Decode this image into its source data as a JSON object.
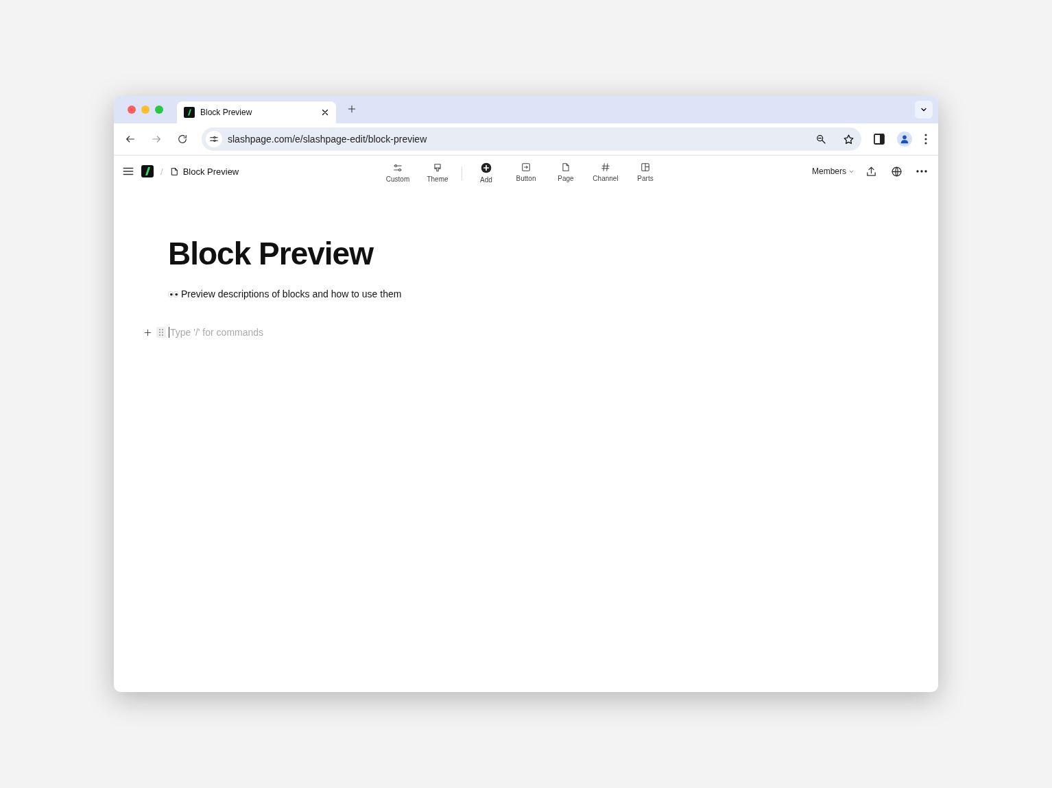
{
  "browser": {
    "tab": {
      "title": "Block Preview"
    },
    "url": "slashpage.com/e/slashpage-edit/block-preview"
  },
  "header": {
    "breadcrumb_separator": "/",
    "breadcrumb": "Block Preview",
    "tool_groups": [
      {
        "items": [
          {
            "label": "Custom",
            "kind": "sliders"
          },
          {
            "label": "Theme",
            "kind": "brush"
          }
        ]
      },
      {
        "items": [
          {
            "label": "Add",
            "kind": "add"
          },
          {
            "label": "Button",
            "kind": "button"
          },
          {
            "label": "Page",
            "kind": "page"
          },
          {
            "label": "Channel",
            "kind": "hash"
          },
          {
            "label": "Parts",
            "kind": "layout"
          }
        ]
      }
    ],
    "members": "Members"
  },
  "page": {
    "title": "Block Preview",
    "description": "Preview descriptions of blocks and how to use them",
    "placeholder": "Type '/' for commands"
  }
}
